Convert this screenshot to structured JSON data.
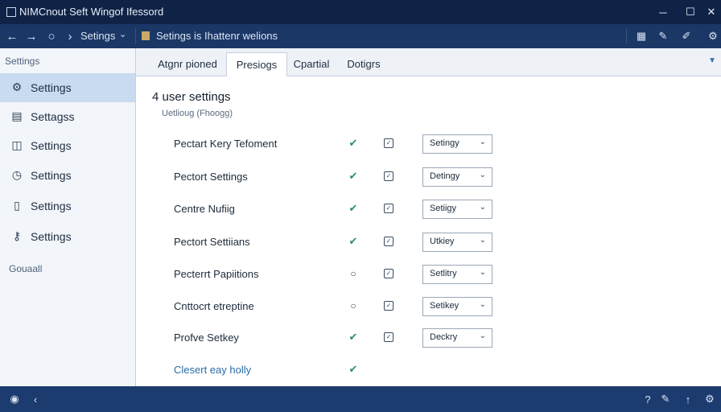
{
  "window": {
    "title": "NIMCnout Seft Wingof Ifessord"
  },
  "navbar": {
    "crumb": "Setings",
    "address": "Setings is Ihattenr welions"
  },
  "sidebar": {
    "header": "Settings",
    "items": [
      {
        "label": "Settings",
        "icon": "gear-icon"
      },
      {
        "label": "Settagss",
        "icon": "document-icon"
      },
      {
        "label": "Settings",
        "icon": "layout-icon"
      },
      {
        "label": "Settings",
        "icon": "clock-icon"
      },
      {
        "label": "Settings",
        "icon": "file-icon"
      },
      {
        "label": "Settings",
        "icon": "key-icon"
      }
    ],
    "footer": "Gouaall"
  },
  "tabs": [
    "Atgnr pioned",
    "Presiogs",
    "Cpartial",
    "Dotigrs"
  ],
  "main": {
    "heading": "4 user settings",
    "subheading": "Uetlioug (Fhoogg)",
    "rows": [
      {
        "label": "Pectart Kery Tefoment",
        "status": "check",
        "select": "Setingy"
      },
      {
        "label": "Pectort Settings",
        "status": "check",
        "select": "Detingy"
      },
      {
        "label": "Centre Nufiig",
        "status": "check",
        "select": "Setiigy"
      },
      {
        "label": "Pectort Settiians",
        "status": "check",
        "select": "Utkiey"
      },
      {
        "label": "Pecterrt Papiitions",
        "status": "circle",
        "select": "Setlitry"
      },
      {
        "label": "Cnttocrt etreptine",
        "status": "circle",
        "select": "Setikey"
      },
      {
        "label": "Profve Setkey",
        "status": "check",
        "select": "Deckry"
      },
      {
        "label": "Clesert eay holly",
        "status": "check",
        "select": null
      }
    ]
  },
  "colors": {
    "accent": "#2a8d72",
    "titlebar": "#0f2347",
    "navbar": "#1a3766",
    "sidebar_active": "#c9dbf0"
  }
}
